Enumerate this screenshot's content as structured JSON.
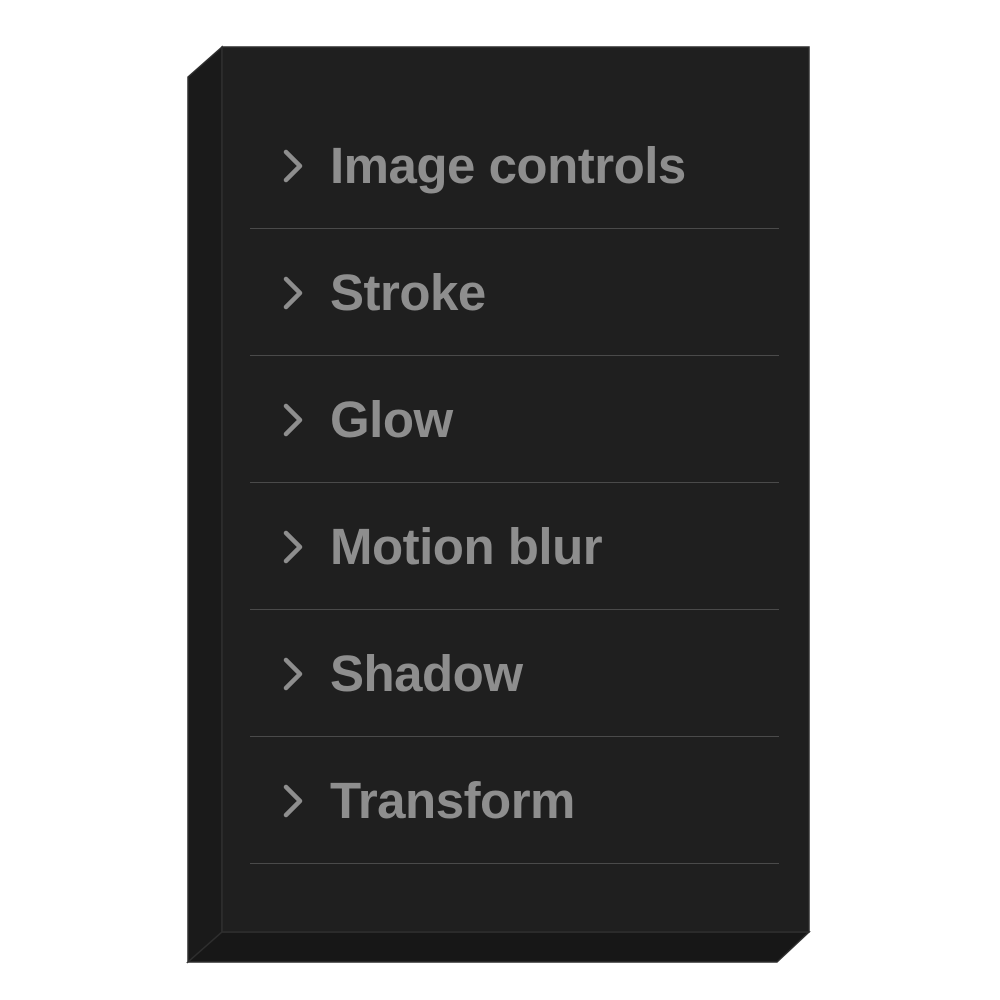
{
  "colors": {
    "panel_face": "#1f1f1f",
    "panel_left_side": "#1a1a1a",
    "panel_bottom_side": "#171717",
    "panel_edge": "#2e2e2e",
    "divider": "#4a4a4a",
    "label_text": "#8e8e8e",
    "chevron": "#8e8e8e"
  },
  "panel": {
    "sections": [
      {
        "label": "Image controls",
        "icon": "chevron-right-icon"
      },
      {
        "label": "Stroke",
        "icon": "chevron-right-icon"
      },
      {
        "label": "Glow",
        "icon": "chevron-right-icon"
      },
      {
        "label": "Motion blur",
        "icon": "chevron-right-icon"
      },
      {
        "label": "Shadow",
        "icon": "chevron-right-icon"
      },
      {
        "label": "Transform",
        "icon": "chevron-right-icon"
      }
    ]
  }
}
